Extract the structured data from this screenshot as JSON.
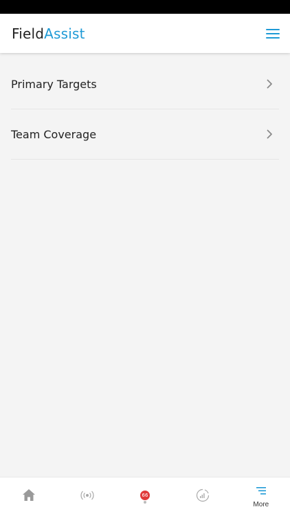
{
  "header": {
    "logo_part1": "Field",
    "logo_part2": "Assist",
    "accent_color": "#1e9ad6",
    "menu_icon": "hamburger-menu-icon"
  },
  "menu": {
    "items": [
      {
        "label": "Primary Targets",
        "icon": "chevron-right-icon"
      },
      {
        "label": "Team Coverage",
        "icon": "chevron-right-icon"
      }
    ]
  },
  "bottom_nav": {
    "items": [
      {
        "icon": "home-icon"
      },
      {
        "icon": "broadcast-icon"
      },
      {
        "icon": "notification-icon",
        "badge": "66",
        "badge_color": "#e03a3a"
      },
      {
        "icon": "analytics-icon"
      },
      {
        "icon": "more-icon",
        "label": "More"
      }
    ]
  }
}
